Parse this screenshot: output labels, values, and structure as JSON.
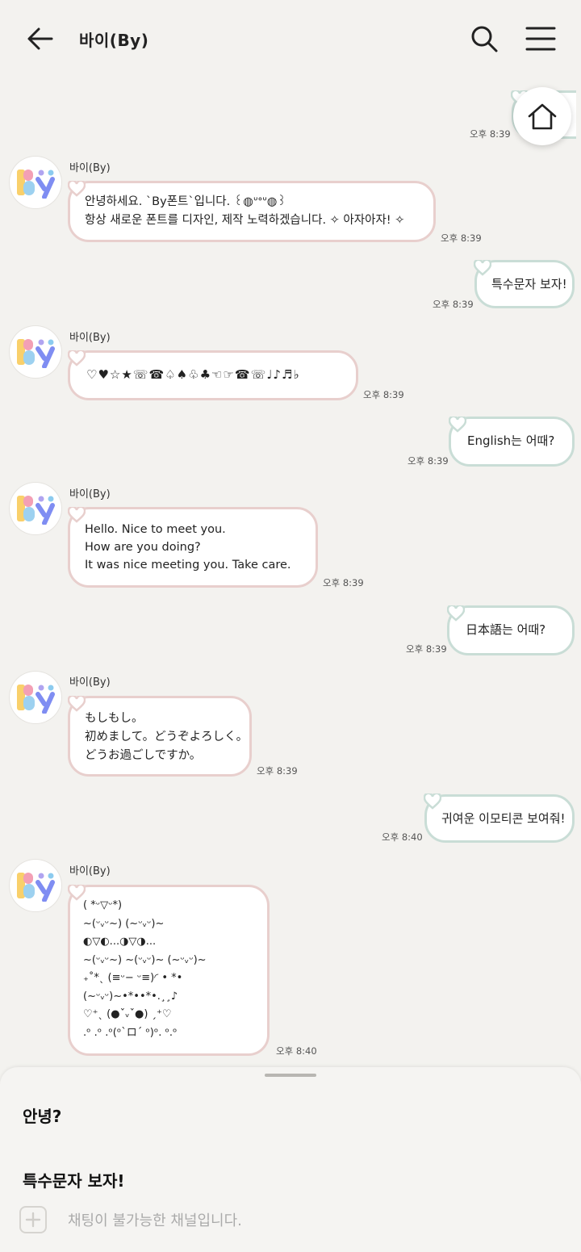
{
  "header": {
    "title": "바이(By)"
  },
  "icons": {
    "back": "arrow-left-icon",
    "search": "search-icon",
    "menu": "hamburger-menu-icon",
    "home": "home-icon",
    "plus": "plus-icon",
    "heart": "heart-icon"
  },
  "colors": {
    "incoming_border": "#e8cfcd",
    "outgoing_border": "#c9ddd6",
    "background": "#f3f2ef"
  },
  "messages": [
    {
      "type": "out",
      "time": "오후 8:39",
      "text": ""
    },
    {
      "type": "in",
      "sender": "바이(By)",
      "time": "오후 8:39",
      "text": "안녕하세요. `By폰트`입니다. ꒰◍ᐡᐤᐡ◍꒱\n항상 새로운 폰트를 디자인, 제작 노력하겠습니다. ✧ 아자아자! ✧"
    },
    {
      "type": "out",
      "time": "오후 8:39",
      "text": "특수문자 보자!"
    },
    {
      "type": "in",
      "sender": "바이(By)",
      "time": "오후 8:39",
      "text": "♡♥☆★☏☎♤♠♧♣☜☞☎☏♩♪♬♭"
    },
    {
      "type": "out",
      "time": "오후 8:39",
      "text": "English는 어때?"
    },
    {
      "type": "in",
      "sender": "바이(By)",
      "time": "오후 8:39",
      "text": "Hello. Nice to meet you.\nHow are you doing?\nIt was nice meeting you. Take care."
    },
    {
      "type": "out",
      "time": "오후 8:39",
      "text": "日本語는 어때?"
    },
    {
      "type": "in",
      "sender": "바이(By)",
      "time": "오후 8:39",
      "text": "もしもし。\n初めまして。どうぞよろしく。\nどうお過ごしですか。"
    },
    {
      "type": "out",
      "time": "오후 8:40",
      "text": "귀여운 이모티콘 보여줘!"
    },
    {
      "type": "in",
      "sender": "바이(By)",
      "time": "오후 8:40",
      "text": "( *ᵕ▽ᵕ*)\n~(ᵕᵥᵕ~) (~ᵕᵥᵕ)~\n◐▽◐...◑▽◑...\n~(ᵕᵥᵕ~) ~(ᵕᵥᵕ)~ (~ᵕᵥᵕ)~\n₊˚*ˎ (≡ᵕ− ᵕ≡)◜ • *•\n(~ᵕᵥᵕ)~•*••*•.¸¸♪\n♡⁺ˎ (●ˇᵥˇ●) ˏ⁺♡\n.ᵒ .ᵒ .ᵒ(ᵒ`ロ´ ᵒ)ᵒ. ᵒ.ᵒ"
    }
  ],
  "quick_replies": [
    "안녕?",
    "특수문자 보자!"
  ],
  "input": {
    "placeholder": "채팅이 불가능한 채널입니다."
  }
}
